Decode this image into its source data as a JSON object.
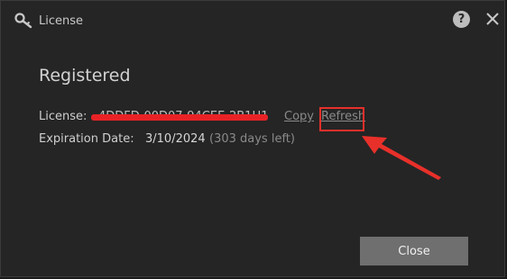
{
  "window": {
    "title": "License"
  },
  "icons": {
    "title": "key-icon",
    "help": "help-icon",
    "close": "close-icon"
  },
  "status": {
    "heading": "Registered"
  },
  "license": {
    "label": "License:",
    "value": "4DDFD-00D07-94CEE-2B1H1",
    "copy_link": "Copy",
    "refresh_link": "Refresh"
  },
  "expiration": {
    "label": "Expiration Date:",
    "date": "3/10/2024",
    "days_left": "(303 days left)"
  },
  "footer": {
    "close_button": "Close"
  },
  "help": {
    "symbol": "?"
  },
  "colors": {
    "background": "#252525",
    "annotation_red": "#e8302a",
    "button": "#6f6f6f"
  }
}
